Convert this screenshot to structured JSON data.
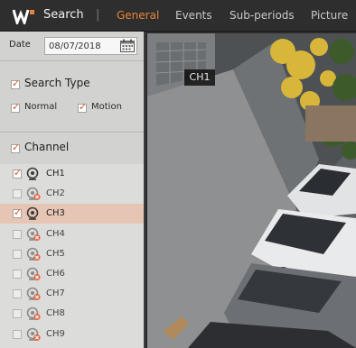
{
  "header": {
    "app_title": "Search",
    "separator": "|",
    "tabs": [
      {
        "label": "General",
        "active": true
      },
      {
        "label": "Events",
        "active": false
      },
      {
        "label": "Sub-periods",
        "active": false
      },
      {
        "label": "Picture",
        "active": false
      }
    ],
    "accent_color": "#e8853a"
  },
  "panel": {
    "date": {
      "label": "Date",
      "value": "08/07/2018"
    },
    "search_type": {
      "label": "Search Type",
      "checked": true,
      "options": [
        {
          "label": "Normal",
          "checked": true
        },
        {
          "label": "Motion",
          "checked": true
        }
      ]
    },
    "channel": {
      "label": "Channel",
      "checked": true,
      "items": [
        {
          "name": "CH1",
          "checked": true,
          "enabled": true,
          "selected": false
        },
        {
          "name": "CH2",
          "checked": false,
          "enabled": false,
          "selected": false
        },
        {
          "name": "CH3",
          "checked": true,
          "enabled": true,
          "selected": true
        },
        {
          "name": "CH4",
          "checked": false,
          "enabled": false,
          "selected": false
        },
        {
          "name": "CH5",
          "checked": false,
          "enabled": false,
          "selected": false
        },
        {
          "name": "CH6",
          "checked": false,
          "enabled": false,
          "selected": false
        },
        {
          "name": "CH7",
          "checked": false,
          "enabled": false,
          "selected": false
        },
        {
          "name": "CH8",
          "checked": false,
          "enabled": false,
          "selected": false
        },
        {
          "name": "CH9",
          "checked": false,
          "enabled": false,
          "selected": false
        }
      ]
    }
  },
  "video": {
    "channel_label": "CH1"
  }
}
